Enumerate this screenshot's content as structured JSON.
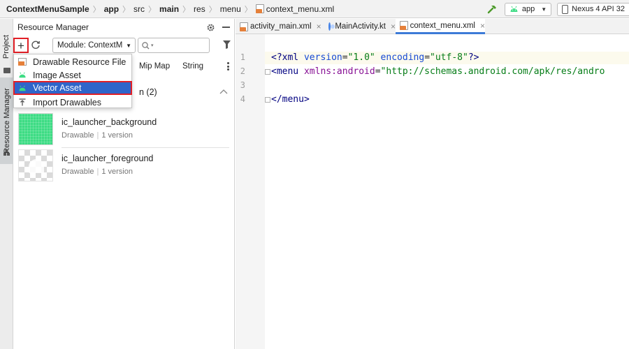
{
  "navbar": {
    "breadcrumbs": [
      {
        "label": "ContextMenuSample",
        "bold": true
      },
      {
        "label": "app",
        "bold": true
      },
      {
        "label": "src",
        "bold": false
      },
      {
        "label": "main",
        "bold": true
      },
      {
        "label": "res",
        "bold": false
      },
      {
        "label": "menu",
        "bold": false
      },
      {
        "label": "context_menu.xml",
        "bold": false
      }
    ],
    "run_config": "app",
    "device": "Nexus 4 API 32"
  },
  "stripe": {
    "project_tab": "Project",
    "resource_manager_tab": "Resource Manager"
  },
  "panel": {
    "title": "Resource Manager",
    "add_label": "+",
    "module_select": "Module: ContextM",
    "tabs": [
      "Mip Map",
      "String"
    ],
    "section_title": "n (2)",
    "resources": [
      {
        "name": "ic_launcher_background",
        "type": "Drawable",
        "versions": "1 version"
      },
      {
        "name": "ic_launcher_foreground",
        "type": "Drawable",
        "versions": "1 version"
      }
    ]
  },
  "add_menu": {
    "items": [
      {
        "label": "Drawable Resource File",
        "icon": "drawable-file-icon"
      },
      {
        "label": "Image Asset",
        "icon": "android-icon"
      },
      {
        "label": "Vector Asset",
        "icon": "android-icon",
        "selected": true
      },
      {
        "label": "Import Drawables",
        "icon": "import-icon"
      }
    ]
  },
  "editor": {
    "tabs": [
      {
        "label": "activity_main.xml",
        "icon": "xml-file-icon"
      },
      {
        "label": "MainActivity.kt",
        "icon": "kotlin-icon"
      },
      {
        "label": "context_menu.xml",
        "icon": "xml-file-icon",
        "active": true
      }
    ],
    "line_numbers": [
      "1",
      "2",
      "3",
      "4"
    ],
    "code": {
      "line1": {
        "open": "<?xml",
        "attr1": " version",
        "eq1": "=",
        "val1": "\"1.0\"",
        "attr2": " encoding",
        "eq2": "=",
        "val2": "\"utf-8\"",
        "close": "?>"
      },
      "line2": {
        "open": "<menu",
        "ns": " xmlns:android",
        "eq": "=",
        "val": "\"http://schemas.android.com/apk/res/andro"
      },
      "line4": {
        "close": "</menu>"
      }
    }
  },
  "colors": {
    "selection_blue": "#2f65ca",
    "highlight_red": "#e11f26",
    "android_green": "#3ddc84",
    "active_tab_underline": "#3d7bd7"
  }
}
